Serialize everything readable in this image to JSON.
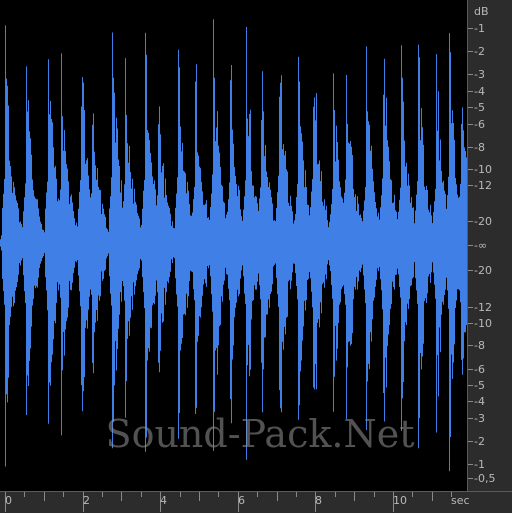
{
  "window": {
    "watermark_text": "Sound-Pack.Net"
  },
  "waveform": {
    "color": "#3f7fe6",
    "background": "#000000",
    "peak_times_sec": [
      0.0,
      0.55,
      1.1,
      1.45,
      1.95,
      2.25,
      2.75,
      3.1,
      3.6,
      3.95,
      4.45,
      4.9,
      5.35,
      5.8,
      6.2,
      6.6,
      7.05,
      7.55,
      7.95,
      8.45,
      8.8,
      9.3,
      9.75,
      10.2,
      10.65,
      11.1,
      11.45,
      11.75
    ]
  },
  "db_ruler": {
    "unit": "dB",
    "top_labels": [
      "-1",
      "-2",
      "-3",
      "-4",
      "-5",
      "-6",
      "-8",
      "-10",
      "-12",
      "-20"
    ],
    "center_label": "-∞",
    "bottom_labels": [
      "-20",
      "-12",
      "-10",
      "-8",
      "-6",
      "-5",
      "-4",
      "-3",
      "-2",
      "-1",
      "-0,5"
    ]
  },
  "time_ruler": {
    "unit": "sec",
    "labels": [
      "0",
      "2",
      "4",
      "6",
      "8",
      "10"
    ]
  }
}
